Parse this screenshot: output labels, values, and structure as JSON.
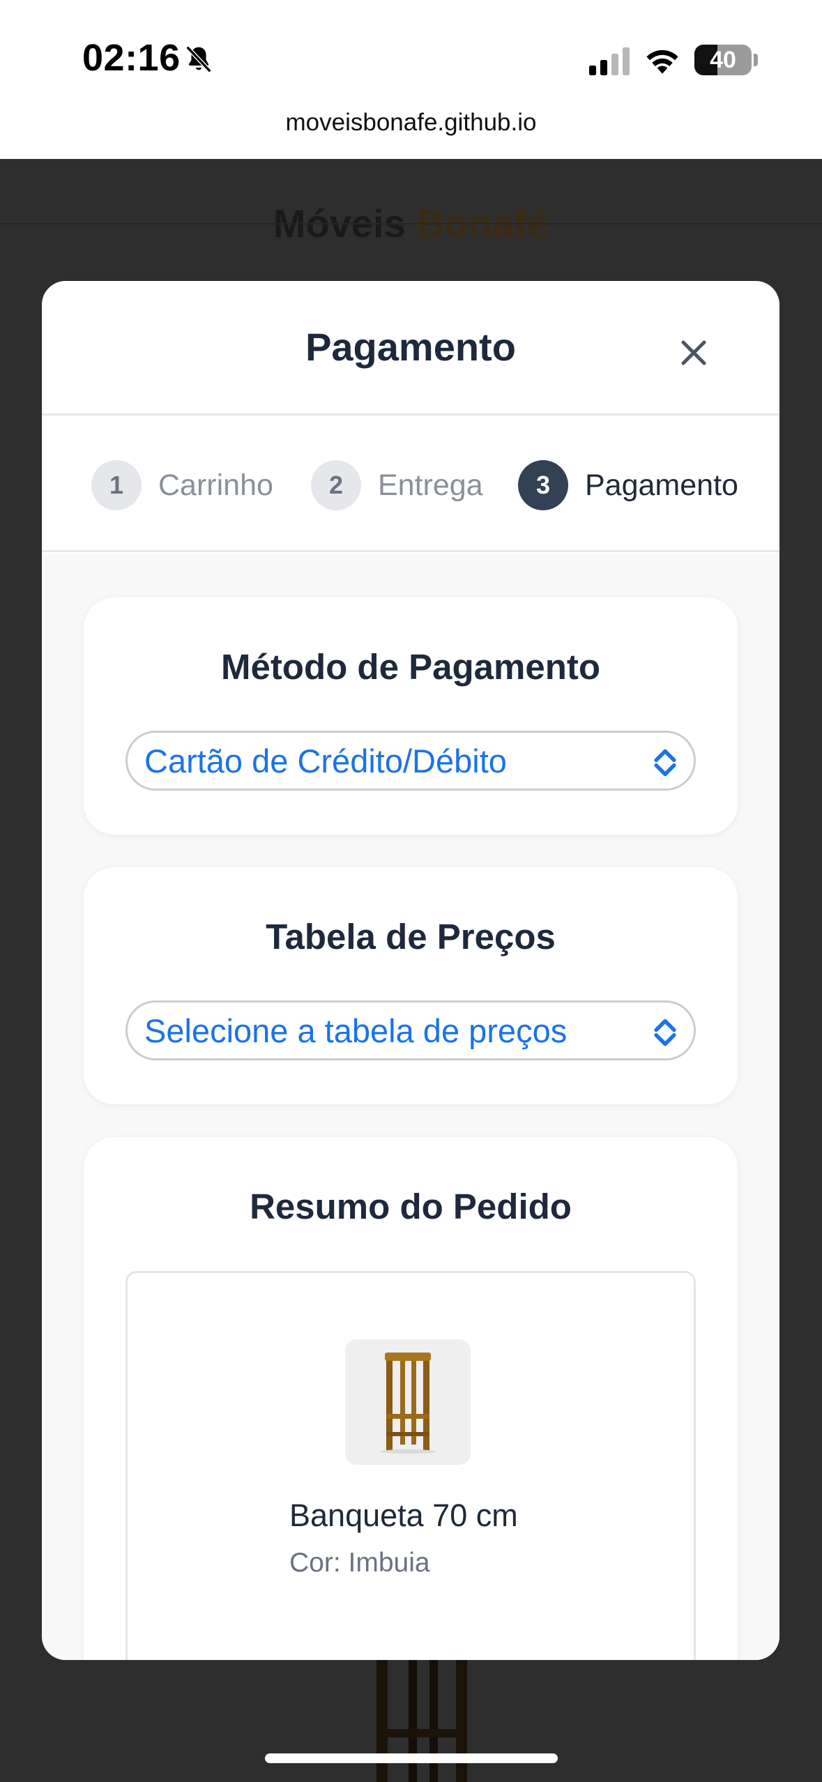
{
  "status_bar": {
    "time": "02:16",
    "battery_level": 40,
    "battery_text": "40",
    "icons": [
      "bell-slash-icon",
      "signal-icon",
      "wifi-icon",
      "battery-icon"
    ]
  },
  "browser": {
    "url": "moveisbonafe.github.io"
  },
  "background_page": {
    "brand_part1": "Móveis",
    "brand_part2": "Bonafé"
  },
  "modal": {
    "title": "Pagamento",
    "close_icon": "close-icon",
    "steps": [
      {
        "number": "1",
        "label": "Carrinho",
        "state": "inactive"
      },
      {
        "number": "2",
        "label": "Entrega",
        "state": "inactive"
      },
      {
        "number": "3",
        "label": "Pagamento",
        "state": "active"
      }
    ],
    "payment_method": {
      "title": "Método de Pagamento",
      "selected": "Cartão de Crédito/Débito"
    },
    "price_table": {
      "title": "Tabela de Preços",
      "selected": "Selecione a tabela de preços"
    },
    "order_summary": {
      "title": "Resumo do Pedido",
      "items": [
        {
          "name": "Banqueta 70 cm",
          "color": "Cor: Imbuia"
        }
      ]
    }
  },
  "colors": {
    "accent_blue": "#1a73e8",
    "step_active": "#334155",
    "title_dark": "#1e293b"
  }
}
